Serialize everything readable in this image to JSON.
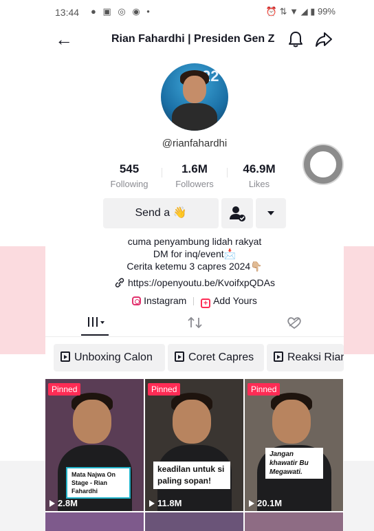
{
  "status_bar": {
    "time": "13:44",
    "notifications": "● ▣ ◎ ◉ •",
    "right": "⏰ ⇅ ▼ ◢ ▮ 99%"
  },
  "header": {
    "title": "Rian Fahardhi | Presiden Gen Z",
    "back_icon": "arrow-left-icon",
    "bell_icon": "bell-icon",
    "share_icon": "share-icon"
  },
  "profile": {
    "handle": "@rianfahardhi",
    "stats": [
      {
        "value": "545",
        "label": "Following"
      },
      {
        "value": "1.6M",
        "label": "Followers"
      },
      {
        "value": "46.9M",
        "label": "Likes"
      }
    ],
    "send_button": "Send a 👋",
    "bio_lines": [
      "cuma penyambung lidah rakyat",
      "DM for inq/event📩",
      "Cerita ketemu 3 capres 2024👇🏼"
    ],
    "link": "https://openyoutu.be/KvoifxpQDAs",
    "instagram_label": "Instagram",
    "add_yours_label": "Add Yours"
  },
  "playlists": [
    "Unboxing Calon",
    "Coret Capres",
    "Reaksi Rian"
  ],
  "videos": [
    {
      "pinned": "Pinned",
      "views": "2.8M",
      "caption": "Mata Najwa On Stage - Rian Fahardhi",
      "bg": "#5a3d55"
    },
    {
      "pinned": "Pinned",
      "views": "11.8M",
      "caption": "keadilan untuk si paling sopan!",
      "bg": "#3a3531"
    },
    {
      "pinned": "Pinned",
      "views": "20.1M",
      "caption": "Jangan khawatir Bu Megawati.",
      "bg": "#6e655d"
    }
  ],
  "colors": {
    "accent": "#fe2c55",
    "text": "#161823",
    "muted": "#8a8b91",
    "button_bg": "#f1f1f2"
  }
}
